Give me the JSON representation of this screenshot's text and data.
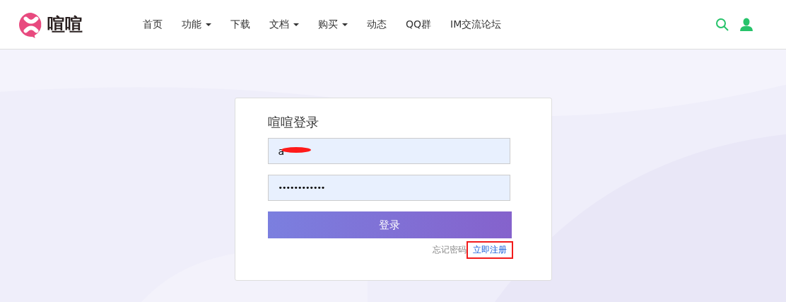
{
  "header": {
    "logo_text": "喧喧",
    "nav": [
      {
        "label": "首页",
        "dropdown": false
      },
      {
        "label": "功能",
        "dropdown": true
      },
      {
        "label": "下载",
        "dropdown": false
      },
      {
        "label": "文档",
        "dropdown": true
      },
      {
        "label": "购买",
        "dropdown": true
      },
      {
        "label": "动态",
        "dropdown": false
      },
      {
        "label": "QQ群",
        "dropdown": false
      },
      {
        "label": "IM交流论坛",
        "dropdown": false
      }
    ]
  },
  "login": {
    "title": "喧喧登录",
    "username": {
      "value": "a",
      "redacted": true
    },
    "password": {
      "value": "••••••••••••"
    },
    "submit": "登录",
    "forgot": "忘记密码",
    "register": {
      "label": "立即注册",
      "highlighted": true
    }
  }
}
